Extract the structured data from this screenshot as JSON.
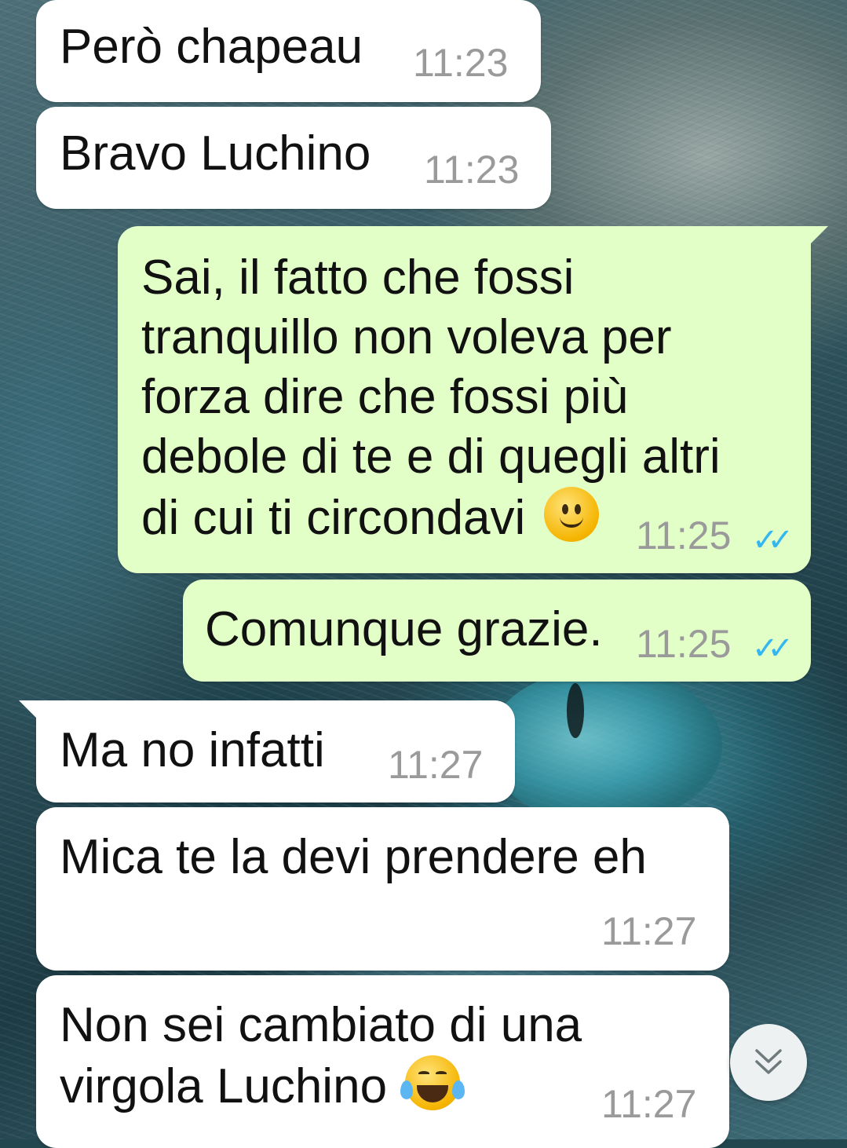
{
  "messages": [
    {
      "text": "Però chapeau",
      "time": "11:23"
    },
    {
      "text": "Bravo Luchino",
      "time": "11:23"
    },
    {
      "lines": [
        "Sai, il fatto che fossi",
        "tranquillo non voleva per",
        "forza dire che fossi più",
        "debole di te e di quegli altri",
        "di cui ti circondavi"
      ],
      "emoji": "slightly-smiling-face",
      "time": "11:25",
      "status": "read"
    },
    {
      "text": "Comunque grazie.",
      "time": "11:25",
      "status": "read"
    },
    {
      "text": "Ma no infatti",
      "time": "11:27"
    },
    {
      "text": "Mica te la devi prendere eh",
      "time": "11:27"
    },
    {
      "lines": [
        "Non sei cambiato di una",
        "virgola Luchino"
      ],
      "emoji": "face-with-tears-of-joy",
      "time": "11:27"
    }
  ],
  "colors": {
    "incoming_bubble": "#ffffff",
    "outgoing_bubble": "#e2ffc7",
    "read_ticks": "#34b7f1",
    "timestamp": "#9a9a9a"
  },
  "icons": {
    "read_status": "double-check-icon",
    "scroll_down": "double-chevron-down-icon"
  }
}
